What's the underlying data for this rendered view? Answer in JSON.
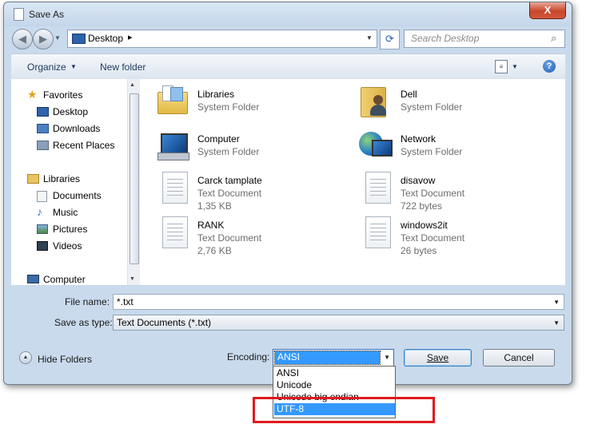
{
  "window": {
    "title": "Save As",
    "close_label": "X"
  },
  "address_bar": {
    "location": "Desktop",
    "chevron": "▸",
    "search_placeholder": "Search Desktop"
  },
  "toolbar": {
    "organize_label": "Organize",
    "new_folder_label": "New folder",
    "help_label": "?"
  },
  "nav_pane": {
    "items": [
      {
        "label": "Favorites",
        "icon": "star-icon"
      },
      {
        "label": "Desktop",
        "icon": "desktop-icon"
      },
      {
        "label": "Downloads",
        "icon": "downloads-icon"
      },
      {
        "label": "Recent Places",
        "icon": "recent-places-icon"
      },
      {
        "label": "Libraries",
        "icon": "libraries-icon"
      },
      {
        "label": "Documents",
        "icon": "documents-icon"
      },
      {
        "label": "Music",
        "icon": "music-icon"
      },
      {
        "label": "Pictures",
        "icon": "pictures-icon"
      },
      {
        "label": "Videos",
        "icon": "videos-icon"
      },
      {
        "label": "Computer",
        "icon": "computer-icon"
      }
    ]
  },
  "files": [
    {
      "name": "Libraries",
      "type": "System Folder",
      "size": "",
      "icon": "libraries-folder-icon"
    },
    {
      "name": "Dell",
      "type": "System Folder",
      "size": "",
      "icon": "user-folder-icon"
    },
    {
      "name": "Computer",
      "type": "System Folder",
      "size": "",
      "icon": "computer-icon"
    },
    {
      "name": "Network",
      "type": "System Folder",
      "size": "",
      "icon": "network-icon"
    },
    {
      "name": "Carck tamplate",
      "type": "Text Document",
      "size": "1,35 KB",
      "icon": "text-document-icon"
    },
    {
      "name": "disavow",
      "type": "Text Document",
      "size": "722 bytes",
      "icon": "text-document-icon"
    },
    {
      "name": "RANK",
      "type": "Text Document",
      "size": "2,76 KB",
      "icon": "text-document-icon"
    },
    {
      "name": "windows2it",
      "type": "Text Document",
      "size": "26 bytes",
      "icon": "text-document-icon"
    }
  ],
  "form": {
    "file_name_label": "File name:",
    "file_name_value": "*.txt",
    "save_as_type_label": "Save as type:",
    "save_as_type_value": "Text Documents (*.txt)",
    "hide_folders_label": "Hide Folders",
    "encoding_label": "Encoding:",
    "encoding_value": "ANSI",
    "save_label": "Save",
    "cancel_label": "Cancel"
  },
  "encoding_options": [
    {
      "label": "ANSI",
      "selected": false
    },
    {
      "label": "Unicode",
      "selected": false
    },
    {
      "label": "Unicode big endian",
      "selected": false
    },
    {
      "label": "UTF-8",
      "selected": true
    }
  ],
  "colors": {
    "selection": "#3399ff",
    "highlight_box": "#e0191e",
    "window_frame": "#c9daec"
  }
}
